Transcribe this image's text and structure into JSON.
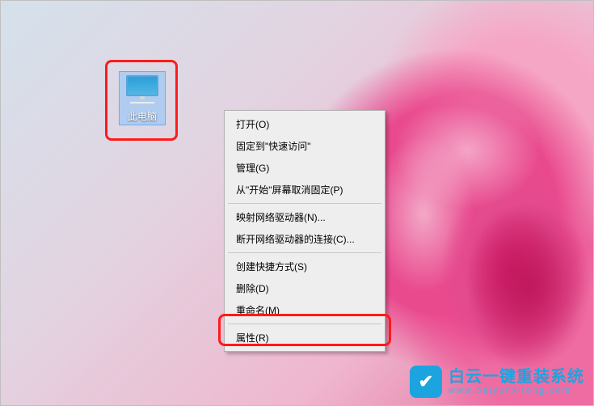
{
  "desktop": {
    "this_pc_label": "此电脑"
  },
  "context_menu": {
    "items": {
      "open": "打开(O)",
      "pin_quick_access": "固定到\"快速访问\"",
      "manage": "管理(G)",
      "unpin_start": "从\"开始\"屏幕取消固定(P)",
      "map_drive": "映射网络驱动器(N)...",
      "disconnect_drive": "断开网络驱动器的连接(C)...",
      "create_shortcut": "创建快捷方式(S)",
      "delete": "删除(D)",
      "rename": "重命名(M)",
      "properties": "属性(R)"
    }
  },
  "watermark": {
    "title": "白云一键重装系统",
    "subtitle": "www.baiyunxitong.com"
  }
}
